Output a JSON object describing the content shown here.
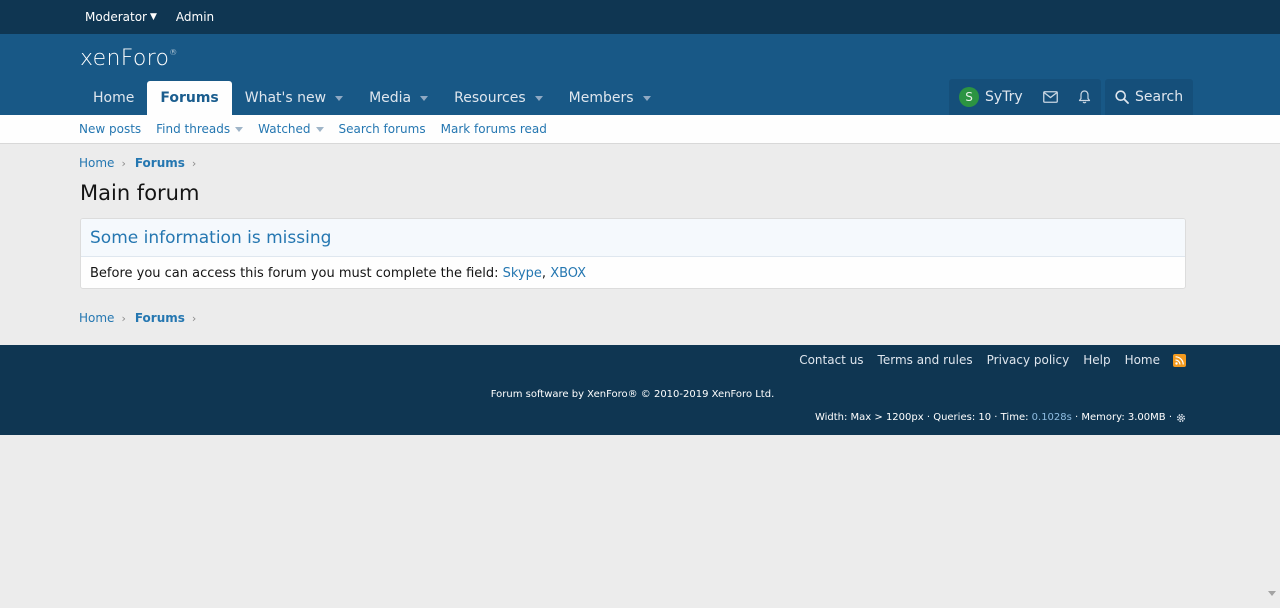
{
  "staff_bar": {
    "moderator": "Moderator",
    "admin": "Admin"
  },
  "header": {
    "logo_text": "xenForo",
    "logo_mark": "®"
  },
  "nav": {
    "tabs": [
      {
        "label": "Home"
      },
      {
        "label": "Forums"
      },
      {
        "label": "What's new"
      },
      {
        "label": "Media"
      },
      {
        "label": "Resources"
      },
      {
        "label": "Members"
      }
    ]
  },
  "user_nav": {
    "avatar_letter": "S",
    "username": "SyTry",
    "search_label": "Search"
  },
  "sub_nav": {
    "items": [
      {
        "label": "New posts"
      },
      {
        "label": "Find threads"
      },
      {
        "label": "Watched"
      },
      {
        "label": "Search forums"
      },
      {
        "label": "Mark forums read"
      }
    ]
  },
  "breadcrumb": {
    "home": "Home",
    "forums": "Forums"
  },
  "page": {
    "title": "Main forum"
  },
  "notice": {
    "header": "Some information is missing",
    "message": "Before you can access this forum you must complete the field: ",
    "field_skype": "Skype",
    "field_sep": ", ",
    "field_xbox": "XBOX"
  },
  "footer": {
    "links": [
      {
        "label": "Contact us"
      },
      {
        "label": "Terms and rules"
      },
      {
        "label": "Privacy policy"
      },
      {
        "label": "Help"
      },
      {
        "label": "Home"
      }
    ],
    "copyright": "Forum software by XenForo® © 2010-2019 XenForo Ltd.",
    "debug_prefix": "Width: Max > 1200px · Queries: 10 · Time: ",
    "debug_time": "0.1028s",
    "debug_suffix": " · Memory: 3.00MB ·"
  },
  "colors": {
    "staff_bar": "#0f3652",
    "header": "#185886",
    "link": "#2577b1",
    "rss": "#f39a1e"
  },
  "icons": {
    "mail": "envelope-icon",
    "alerts": "bell-icon",
    "search": "search-icon",
    "rss": "rss-icon",
    "debug": "gear-icon"
  }
}
